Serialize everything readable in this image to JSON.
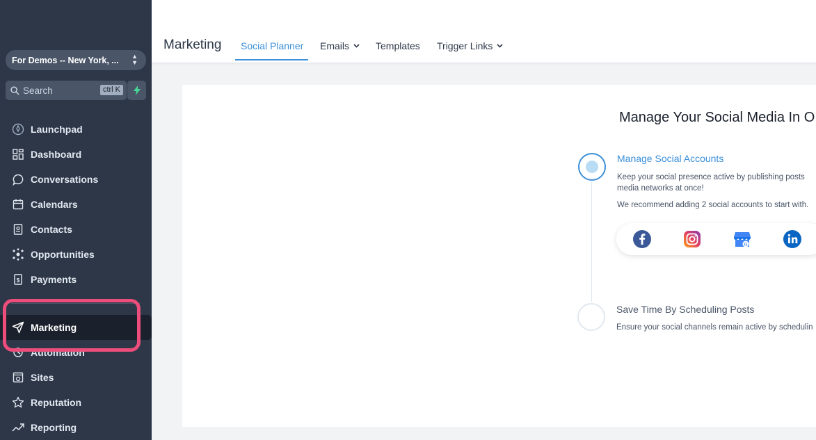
{
  "sidebar": {
    "location": "For Demos -- New York, ...",
    "search_placeholder": "Search",
    "shortcut": "ctrl K",
    "items": [
      {
        "label": "Launchpad",
        "icon": "rocket-icon"
      },
      {
        "label": "Dashboard",
        "icon": "dashboard-icon"
      },
      {
        "label": "Conversations",
        "icon": "chat-icon"
      },
      {
        "label": "Calendars",
        "icon": "calendar-icon"
      },
      {
        "label": "Contacts",
        "icon": "contacts-icon"
      },
      {
        "label": "Opportunities",
        "icon": "opportunities-icon"
      },
      {
        "label": "Payments",
        "icon": "payments-icon"
      },
      {
        "label": "Marketing",
        "icon": "send-icon",
        "active": true
      },
      {
        "label": "Automation",
        "icon": "automation-icon"
      },
      {
        "label": "Sites",
        "icon": "sites-icon"
      },
      {
        "label": "Reputation",
        "icon": "star-icon"
      },
      {
        "label": "Reporting",
        "icon": "chart-icon"
      }
    ]
  },
  "header": {
    "title": "Marketing",
    "tabs": [
      {
        "label": "Social Planner",
        "active": true
      },
      {
        "label": "Emails",
        "dropdown": true
      },
      {
        "label": "Templates"
      },
      {
        "label": "Trigger Links",
        "dropdown": true
      }
    ]
  },
  "main": {
    "title": "Manage Your Social Media In O",
    "step1": {
      "title": "Manage Social Accounts",
      "line1": "Keep your social presence active by publishing posts",
      "line2": "media networks at once!",
      "line3": "We recommend adding 2 social accounts to start with."
    },
    "step2": {
      "title": "Save Time By Scheduling Posts",
      "line1": "Ensure your social channels remain active by schedulin"
    },
    "socials": [
      "facebook-icon",
      "instagram-icon",
      "google-business-icon",
      "linkedin-icon"
    ]
  },
  "colors": {
    "sidebar_bg": "#2d3748",
    "accent": "#3b8fd9",
    "highlight": "#ec4d7a"
  }
}
